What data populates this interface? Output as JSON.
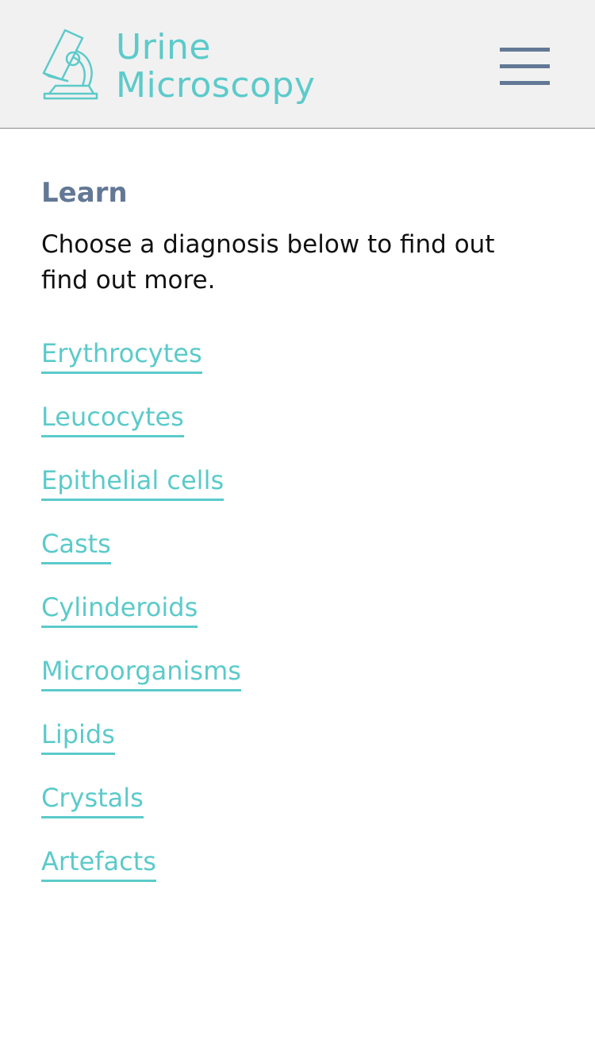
{
  "header": {
    "logo_icon": "microscope-icon",
    "brand_line1": "Urine",
    "brand_line2": "Microscopy",
    "menu_icon": "hamburger-menu-icon"
  },
  "main": {
    "title": "Learn",
    "intro": "Choose a diagnosis below to find out find out more.",
    "links": [
      {
        "label": "Erythrocytes"
      },
      {
        "label": "Leucocytes"
      },
      {
        "label": "Epithelial cells"
      },
      {
        "label": "Casts"
      },
      {
        "label": "Cylinderoids"
      },
      {
        "label": "Microorganisms"
      },
      {
        "label": "Lipids"
      },
      {
        "label": "Crystals"
      },
      {
        "label": "Artefacts"
      }
    ]
  },
  "colors": {
    "accent": "#5ccaca",
    "heading": "#627895",
    "header_bg": "#f1f1f1"
  }
}
